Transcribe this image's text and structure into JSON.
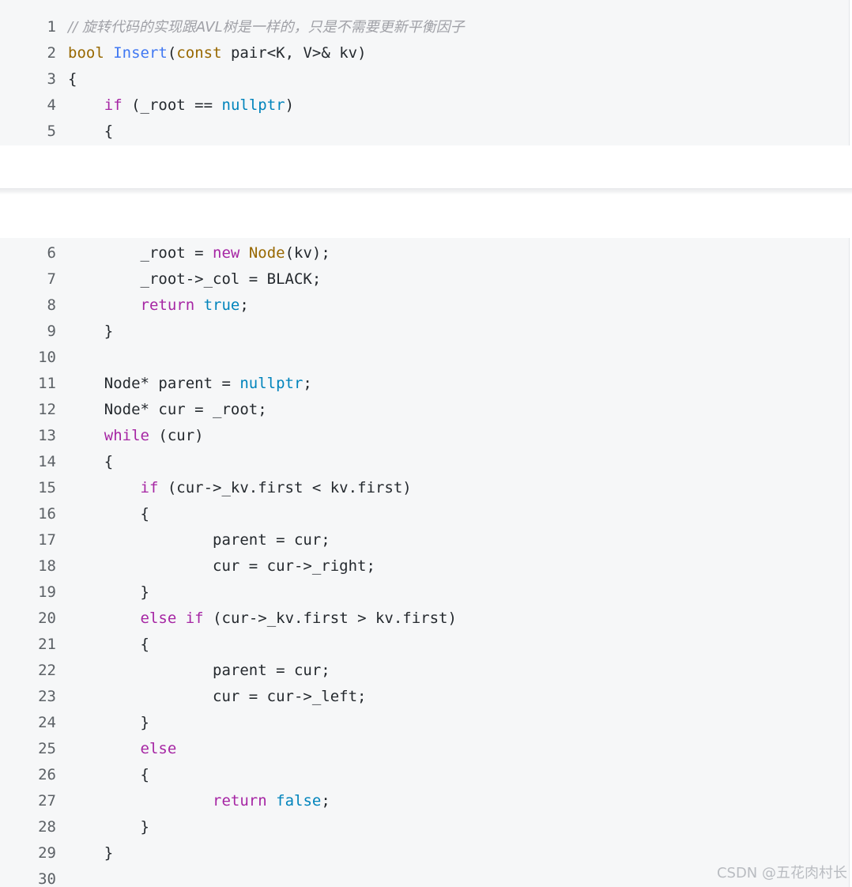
{
  "blocks": [
    {
      "lines": [
        {
          "n": "1",
          "tokens": [
            [
              "// 旋转代码的实现跟AVL树是一样的，只是不需要更新平衡因子",
              "com"
            ]
          ]
        },
        {
          "n": "2",
          "tokens": [
            [
              "bool",
              "type"
            ],
            [
              " ",
              ""
            ],
            [
              "Insert",
              "fn"
            ],
            [
              "(",
              ""
            ],
            [
              "const",
              "type"
            ],
            [
              " pair<K, V>& kv)",
              ""
            ]
          ]
        },
        {
          "n": "3",
          "tokens": [
            [
              "{",
              ""
            ]
          ]
        },
        {
          "n": "4",
          "tokens": [
            [
              "    ",
              ""
            ],
            [
              "if",
              "kw"
            ],
            [
              " (_root == ",
              ""
            ],
            [
              "nullptr",
              "lit"
            ],
            [
              ")",
              ""
            ]
          ]
        },
        {
          "n": "5",
          "tokens": [
            [
              "    {",
              ""
            ]
          ]
        }
      ]
    },
    {
      "lines": [
        {
          "n": "6",
          "tokens": [
            [
              "        _root = ",
              ""
            ],
            [
              "new",
              "kw"
            ],
            [
              " ",
              ""
            ],
            [
              "Node",
              "type"
            ],
            [
              "(kv);",
              ""
            ]
          ]
        },
        {
          "n": "7",
          "tokens": [
            [
              "        _root->_col = BLACK;",
              ""
            ]
          ]
        },
        {
          "n": "8",
          "tokens": [
            [
              "        ",
              ""
            ],
            [
              "return",
              "kw"
            ],
            [
              " ",
              ""
            ],
            [
              "true",
              "lit"
            ],
            [
              ";",
              ""
            ]
          ]
        },
        {
          "n": "9",
          "tokens": [
            [
              "    }",
              ""
            ]
          ]
        },
        {
          "n": "10",
          "tokens": []
        },
        {
          "n": "11",
          "tokens": [
            [
              "    Node* parent = ",
              ""
            ],
            [
              "nullptr",
              "lit"
            ],
            [
              ";",
              ""
            ]
          ]
        },
        {
          "n": "12",
          "tokens": [
            [
              "    Node* cur = _root;",
              ""
            ]
          ]
        },
        {
          "n": "13",
          "tokens": [
            [
              "    ",
              ""
            ],
            [
              "while",
              "kw"
            ],
            [
              " (cur)",
              ""
            ]
          ]
        },
        {
          "n": "14",
          "tokens": [
            [
              "    {",
              ""
            ]
          ]
        },
        {
          "n": "15",
          "tokens": [
            [
              "        ",
              ""
            ],
            [
              "if",
              "kw"
            ],
            [
              " (cur->_kv.first < kv.first)",
              ""
            ]
          ]
        },
        {
          "n": "16",
          "tokens": [
            [
              "        {",
              ""
            ]
          ]
        },
        {
          "n": "17",
          "tokens": [
            [
              "                parent = cur;",
              ""
            ]
          ]
        },
        {
          "n": "18",
          "tokens": [
            [
              "                cur = cur->_right;",
              ""
            ]
          ]
        },
        {
          "n": "19",
          "tokens": [
            [
              "        }",
              ""
            ]
          ]
        },
        {
          "n": "20",
          "tokens": [
            [
              "        ",
              ""
            ],
            [
              "else",
              "kw"
            ],
            [
              " ",
              ""
            ],
            [
              "if",
              "kw"
            ],
            [
              " (cur->_kv.first > kv.first)",
              ""
            ]
          ]
        },
        {
          "n": "21",
          "tokens": [
            [
              "        {",
              ""
            ]
          ]
        },
        {
          "n": "22",
          "tokens": [
            [
              "                parent = cur;",
              ""
            ]
          ]
        },
        {
          "n": "23",
          "tokens": [
            [
              "                cur = cur->_left;",
              ""
            ]
          ]
        },
        {
          "n": "24",
          "tokens": [
            [
              "        }",
              ""
            ]
          ]
        },
        {
          "n": "25",
          "tokens": [
            [
              "        ",
              ""
            ],
            [
              "else",
              "kw"
            ]
          ]
        },
        {
          "n": "26",
          "tokens": [
            [
              "        {",
              ""
            ]
          ]
        },
        {
          "n": "27",
          "tokens": [
            [
              "                ",
              ""
            ],
            [
              "return",
              "kw"
            ],
            [
              " ",
              ""
            ],
            [
              "false",
              "lit"
            ],
            [
              ";",
              ""
            ]
          ]
        },
        {
          "n": "28",
          "tokens": [
            [
              "        }",
              ""
            ]
          ]
        },
        {
          "n": "29",
          "tokens": [
            [
              "    }",
              ""
            ]
          ]
        },
        {
          "n": "30",
          "tokens": []
        }
      ]
    }
  ],
  "watermark": "CSDN @五花肉村长"
}
